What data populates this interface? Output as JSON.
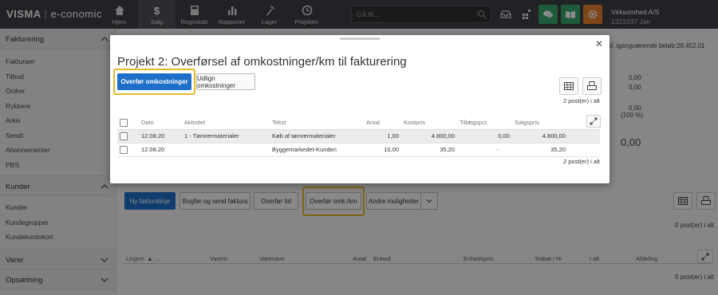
{
  "app": {
    "brand": "VISMA",
    "product": "e-conomic"
  },
  "nav": [
    {
      "label": "Hjem",
      "icon": "home-icon"
    },
    {
      "label": "Salg",
      "icon": "dollar-icon",
      "active": true
    },
    {
      "label": "Regnskab",
      "icon": "calculator-icon"
    },
    {
      "label": "Rapporter",
      "icon": "bar-chart-icon"
    },
    {
      "label": "Lager",
      "icon": "hammer-icon"
    },
    {
      "label": "Projekter",
      "icon": "clock-icon"
    }
  ],
  "search": {
    "placeholder": "Gå til..."
  },
  "company": {
    "name": "Virksomhed A/S",
    "user": "1321037 Jan"
  },
  "colors": {
    "topbar": "#3c3f44",
    "primary": "#1e6fc9",
    "highlight": "#e3b92b",
    "chat_green": "#3aa66c",
    "book_green": "#3aa66c",
    "gear_orange": "#e8812b"
  },
  "sidebar": {
    "sections": [
      {
        "title": "Fakturering",
        "expanded": true,
        "items": [
          "Fakturaer",
          "Tilbud",
          "Ordrer",
          "Rykkere",
          "Arkiv",
          "Sendt",
          "Abonnementer",
          "PBS"
        ]
      },
      {
        "title": "Kunder",
        "expanded": true,
        "items": [
          "Kunder",
          "Kundegrupper",
          "Kundekontokort"
        ]
      },
      {
        "title": "Varer",
        "expanded": false,
        "items": []
      },
      {
        "title": "Opsætning",
        "expanded": false,
        "items": []
      }
    ]
  },
  "background": {
    "summary_label": "Ikl. igangværende beløb:",
    "summary_value": "28.452,01",
    "values": [
      "0,00",
      "0,00",
      "0,00",
      "(100 %)",
      "0,00"
    ],
    "buttons": {
      "new_line": "Ny fakturalinje",
      "book_send": "Bogfør og send faktura",
      "transfer_time": "Overfør tid",
      "transfer_costs": "Overfør omk./km",
      "other": "Andre muligheder"
    },
    "count_top": "0 post(er) i alt",
    "count_bottom": "0 post(er) i alt",
    "columns": [
      "Linjenr.",
      "Varenr.",
      "Varenavn",
      "Antal",
      "Enhed",
      "Enhedspris",
      "Rabat i %",
      "I alt",
      "Afdeling"
    ]
  },
  "modal": {
    "title": "Projekt 2: Overførsel af omkostninger/km til fakturering",
    "primary_button": "Overfør omkostninger",
    "secondary_button": "Udlign omkostninger",
    "count_top": "2 post(er) i alt",
    "count_bottom": "2 post(er) i alt",
    "columns": [
      "Dato",
      "Aktivitet",
      "Tekst",
      "Antal",
      "Kostpris",
      "Tillægspct.",
      "Salgspris"
    ],
    "rows": [
      {
        "dato": "12.08.20",
        "aktivitet": "1 - Tømrermaterialer",
        "tekst": "Køb af tømrermaterialer",
        "antal": "1,00",
        "kostpris": "4.800,00",
        "tillaeg": "0,00",
        "salgspris": "4.800,00"
      },
      {
        "dato": "12.08.20",
        "aktivitet": "",
        "tekst": "Byggemarkedet-Kunden",
        "antal": "10,00",
        "kostpris": "35,20",
        "tillaeg": "-",
        "salgspris": "35,20"
      }
    ]
  }
}
